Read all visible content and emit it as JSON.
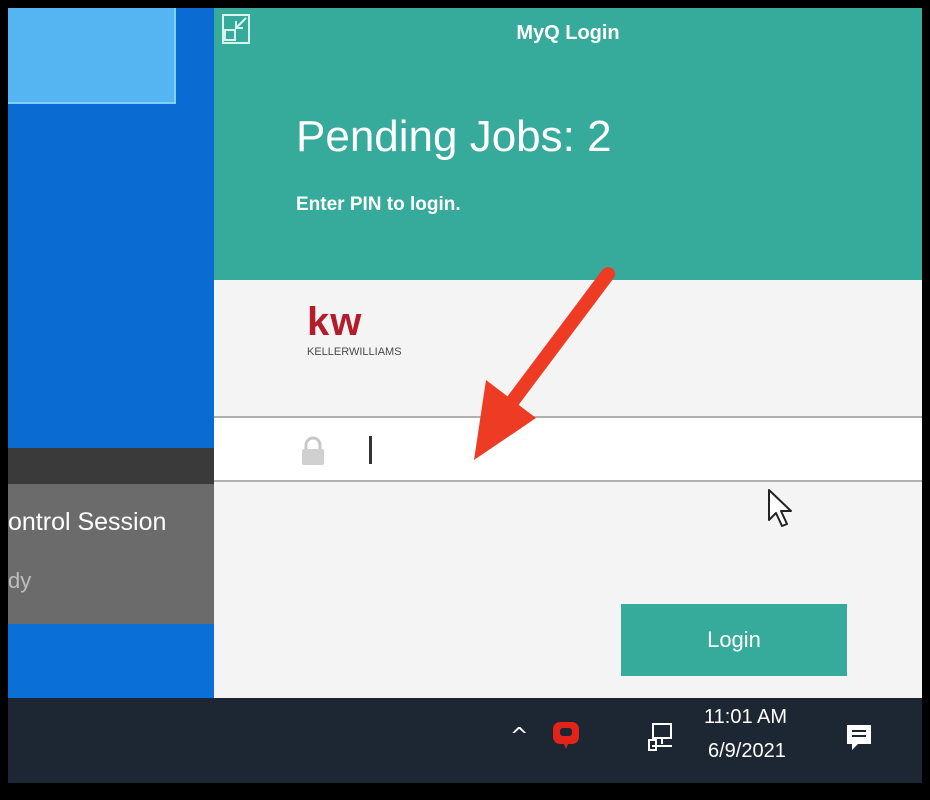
{
  "window": {
    "title": "MyQ Login"
  },
  "header": {
    "pending_jobs": "Pending Jobs: 2",
    "instruction": "Enter PIN to login."
  },
  "logo": {
    "mark": "kw",
    "company": "KELLERWILLIAMS"
  },
  "pin_field": {
    "value": "",
    "placeholder": ""
  },
  "login_button": {
    "label": "Login"
  },
  "session": {
    "title": "ontrol Session",
    "status": "dy"
  },
  "taskbar": {
    "time": "11:01 AM",
    "date": "6/9/2021"
  },
  "colors": {
    "accent": "#36ab9b",
    "logo_red": "#b21d2b",
    "annotation_arrow": "#ee3b24",
    "taskbar": "#1d2733"
  }
}
